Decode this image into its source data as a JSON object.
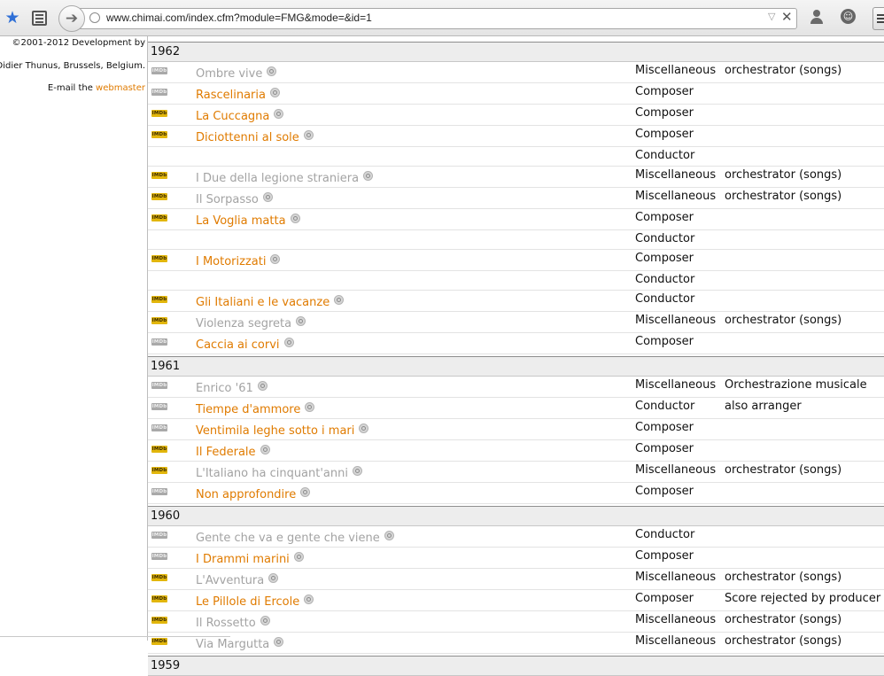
{
  "browser": {
    "url": "www.chimai.com/index.cfm?module=FMG&mode=&id=1",
    "icons": [
      "bookmark-star-icon",
      "reader-view-icon",
      "back-arrow-icon",
      "globe-icon",
      "dropdown-triangle-icon",
      "stop-icon",
      "account-icon",
      "chat-icon",
      "menu-icon"
    ]
  },
  "sidebar": {
    "copyright": "©2001-2012 Development by",
    "author": "Didier Thunus, Brussels, Belgium.",
    "email_prefix": "E-mail the",
    "email_link": "webmaster"
  },
  "colors": {
    "link": "#e07b00",
    "inactive_title": "#a3a3a3",
    "imdb_active": "#e2b60b",
    "imdb_inactive": "#a9a9a9"
  },
  "years": [
    {
      "year": "1962",
      "rows": [
        {
          "imdb": "gray",
          "title": "Ombre vive",
          "grey": true,
          "role": "Miscellaneous",
          "note": "orchestrator (songs)"
        },
        {
          "imdb": "gray",
          "title": "Rascelinaria",
          "grey": false,
          "role": "Composer",
          "note": ""
        },
        {
          "imdb": "yellow",
          "title": "La Cuccagna",
          "grey": false,
          "role": "Composer",
          "note": ""
        },
        {
          "imdb": "yellow",
          "title": "Diciottenni al sole",
          "grey": false,
          "role": "Composer",
          "note": ""
        },
        {
          "imdb": "",
          "title": "",
          "grey": false,
          "role": "Conductor",
          "note": ""
        },
        {
          "imdb": "yellow",
          "title": "I Due della legione straniera",
          "grey": true,
          "role": "Miscellaneous",
          "note": "orchestrator (songs)"
        },
        {
          "imdb": "yellow",
          "title": "Il Sorpasso",
          "grey": true,
          "role": "Miscellaneous",
          "note": "orchestrator (songs)"
        },
        {
          "imdb": "yellow",
          "title": "La Voglia matta",
          "grey": false,
          "role": "Composer",
          "note": ""
        },
        {
          "imdb": "",
          "title": "",
          "grey": false,
          "role": "Conductor",
          "note": ""
        },
        {
          "imdb": "yellow",
          "title": "I Motorizzati",
          "grey": false,
          "role": "Composer",
          "note": ""
        },
        {
          "imdb": "",
          "title": "",
          "grey": false,
          "role": "Conductor",
          "note": ""
        },
        {
          "imdb": "yellow",
          "title": "Gli Italiani e le vacanze",
          "grey": false,
          "role": "Conductor",
          "note": ""
        },
        {
          "imdb": "yellow",
          "title": "Violenza segreta",
          "grey": true,
          "role": "Miscellaneous",
          "note": "orchestrator (songs)"
        },
        {
          "imdb": "gray",
          "title": "Caccia ai corvi",
          "grey": false,
          "role": "Composer",
          "note": ""
        }
      ]
    },
    {
      "year": "1961",
      "rows": [
        {
          "imdb": "gray",
          "title": "Enrico '61",
          "grey": true,
          "role": "Miscellaneous",
          "note": "Orchestrazione musicale"
        },
        {
          "imdb": "gray",
          "title": "Tiempe d'ammore",
          "grey": false,
          "role": "Conductor",
          "note": "also arranger"
        },
        {
          "imdb": "gray",
          "title": "Ventimila leghe sotto i mari",
          "grey": false,
          "role": "Composer",
          "note": ""
        },
        {
          "imdb": "yellow",
          "title": "Il Federale",
          "grey": false,
          "role": "Composer",
          "note": ""
        },
        {
          "imdb": "yellow",
          "title": "L'Italiano ha cinquant'anni",
          "grey": true,
          "role": "Miscellaneous",
          "note": "orchestrator (songs)"
        },
        {
          "imdb": "gray",
          "title": "Non approfondire",
          "grey": false,
          "role": "Composer",
          "note": ""
        }
      ]
    },
    {
      "year": "1960",
      "rows": [
        {
          "imdb": "gray",
          "title": "Gente che va e gente che viene",
          "grey": true,
          "role": "Conductor",
          "note": ""
        },
        {
          "imdb": "gray",
          "title": "I Drammi marini",
          "grey": false,
          "role": "Composer",
          "note": ""
        },
        {
          "imdb": "yellow",
          "title": "L'Avventura",
          "grey": true,
          "role": "Miscellaneous",
          "note": "orchestrator (songs)"
        },
        {
          "imdb": "yellow",
          "title": "Le Pillole di Ercole",
          "grey": false,
          "role": "Composer",
          "note": "Score rejected by producer"
        },
        {
          "imdb": "yellow",
          "title": "Il Rossetto",
          "grey": true,
          "role": "Miscellaneous",
          "note": "orchestrator (songs)"
        },
        {
          "imdb": "yellow",
          "title": "Via Margutta",
          "grey": true,
          "role": "Miscellaneous",
          "note": "orchestrator (songs)"
        }
      ]
    },
    {
      "year": "1959",
      "rows": []
    }
  ]
}
